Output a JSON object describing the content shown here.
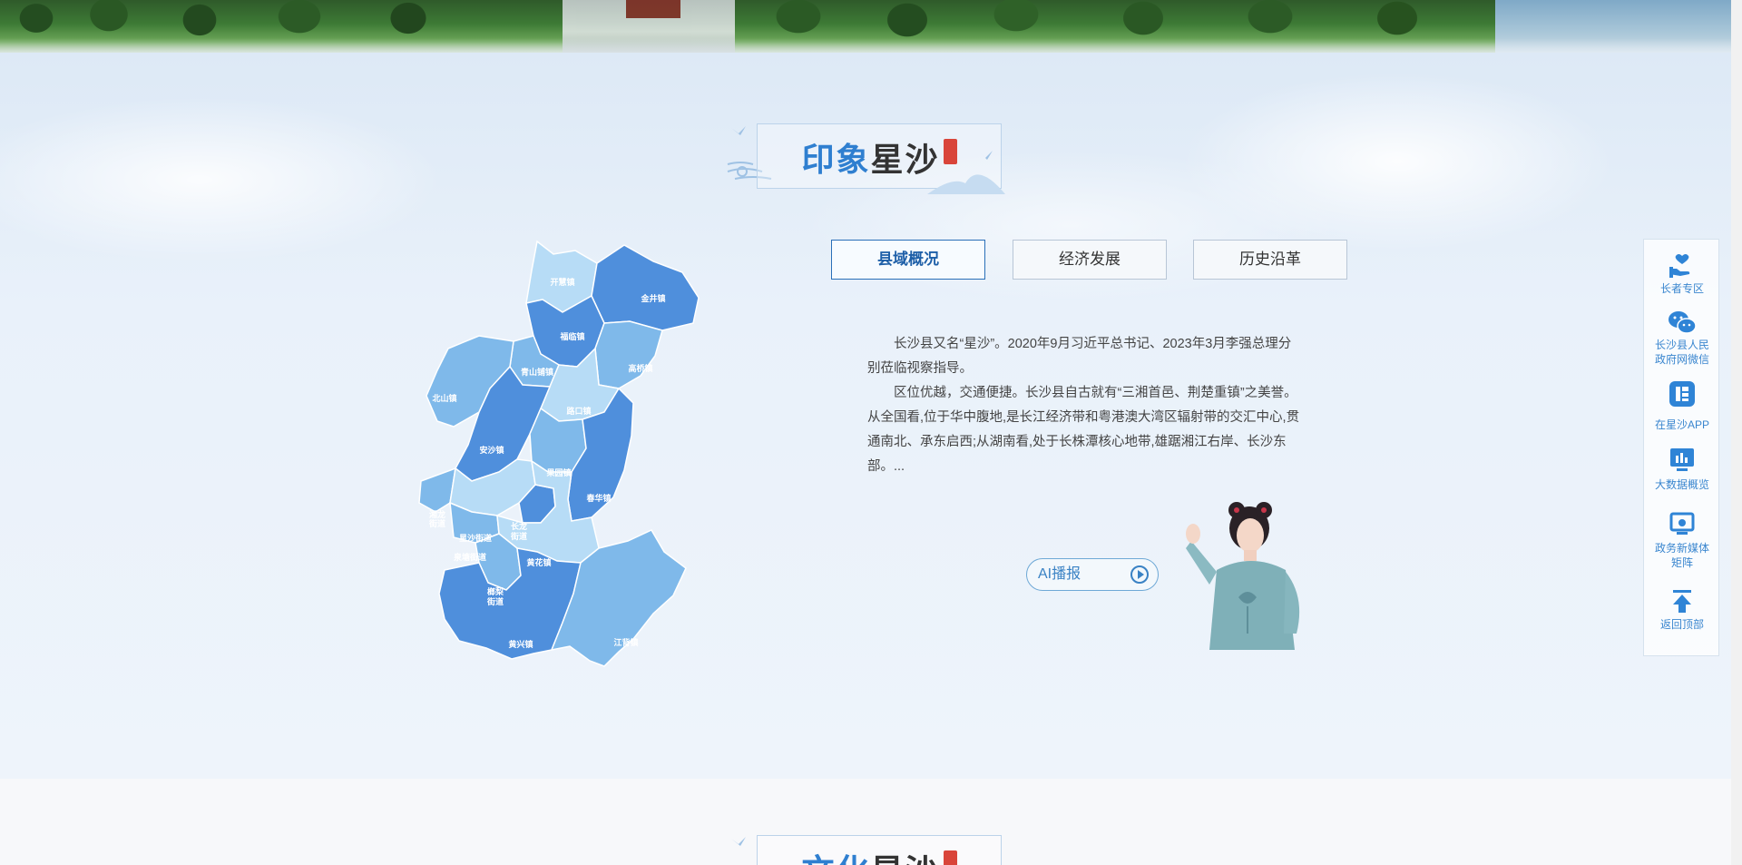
{
  "section1": {
    "title_highlight": "印象",
    "title_name": "星沙",
    "tabs": [
      {
        "label": "县域概况",
        "active": true
      },
      {
        "label": "经济发展",
        "active": false
      },
      {
        "label": "历史沿革",
        "active": false
      }
    ],
    "paragraph1": "长沙县又名“星沙”。2020年9月习近平总书记、2023年3月李强总理分别莅临视察指导。",
    "paragraph2": "区位优越，交通便捷。长沙县自古就有“三湘首邑、荆楚重镇”之美誉。从全国看,位于华中腹地,是长江经济带和粤港澳大湾区辐射带的交汇中心,贯通南北、承东启西;从湖南看,处于长株潭核心地带,雄踞湘江右岸、长沙东部。...",
    "ai_button": "AI播报"
  },
  "map": {
    "regions": [
      {
        "name": "开慧镇",
        "shade": "light"
      },
      {
        "name": "金井镇",
        "shade": "dark"
      },
      {
        "name": "福临镇",
        "shade": "dark"
      },
      {
        "name": "青山铺镇",
        "shade": "mid"
      },
      {
        "name": "高桥镇",
        "shade": "mid"
      },
      {
        "name": "北山镇",
        "shade": "mid"
      },
      {
        "name": "路口镇",
        "shade": "light"
      },
      {
        "name": "安沙镇",
        "shade": "dark"
      },
      {
        "name": "果园镇",
        "shade": "mid"
      },
      {
        "name": "春华镇",
        "shade": "dark"
      },
      {
        "name": "湘龙街道",
        "shade": "mid"
      },
      {
        "name": "星沙街道",
        "shade": "light"
      },
      {
        "name": "长龙街道",
        "shade": "dark"
      },
      {
        "name": "泉塘街道",
        "shade": "mid"
      },
      {
        "name": "黄花镇",
        "shade": "light"
      },
      {
        "name": "榔梨街道",
        "shade": "mid"
      },
      {
        "name": "黄兴镇",
        "shade": "dark"
      },
      {
        "name": "江背镇",
        "shade": "mid"
      }
    ],
    "colors": {
      "light": "#b7dcf6",
      "mid": "#7fb9ea",
      "dark": "#4f8fdc"
    }
  },
  "sidebar": {
    "items": [
      {
        "label": "长者专区",
        "icon": "elder-care-icon"
      },
      {
        "label": "长沙县人民政府网微信",
        "icon": "wechat-icon"
      },
      {
        "label": "在星沙APP",
        "icon": "app-icon"
      },
      {
        "label": "大数据概览",
        "icon": "data-screen-icon"
      },
      {
        "label": "政务新媒体矩阵",
        "icon": "media-matrix-icon"
      },
      {
        "label": "返回顶部",
        "icon": "back-to-top-icon"
      }
    ]
  },
  "section2": {
    "title_highlight": "文化",
    "title_name": "星沙"
  },
  "colors": {
    "accent": "#2f7fd0",
    "sidebar_text": "#3a86cf",
    "seal": "#d9453a"
  }
}
